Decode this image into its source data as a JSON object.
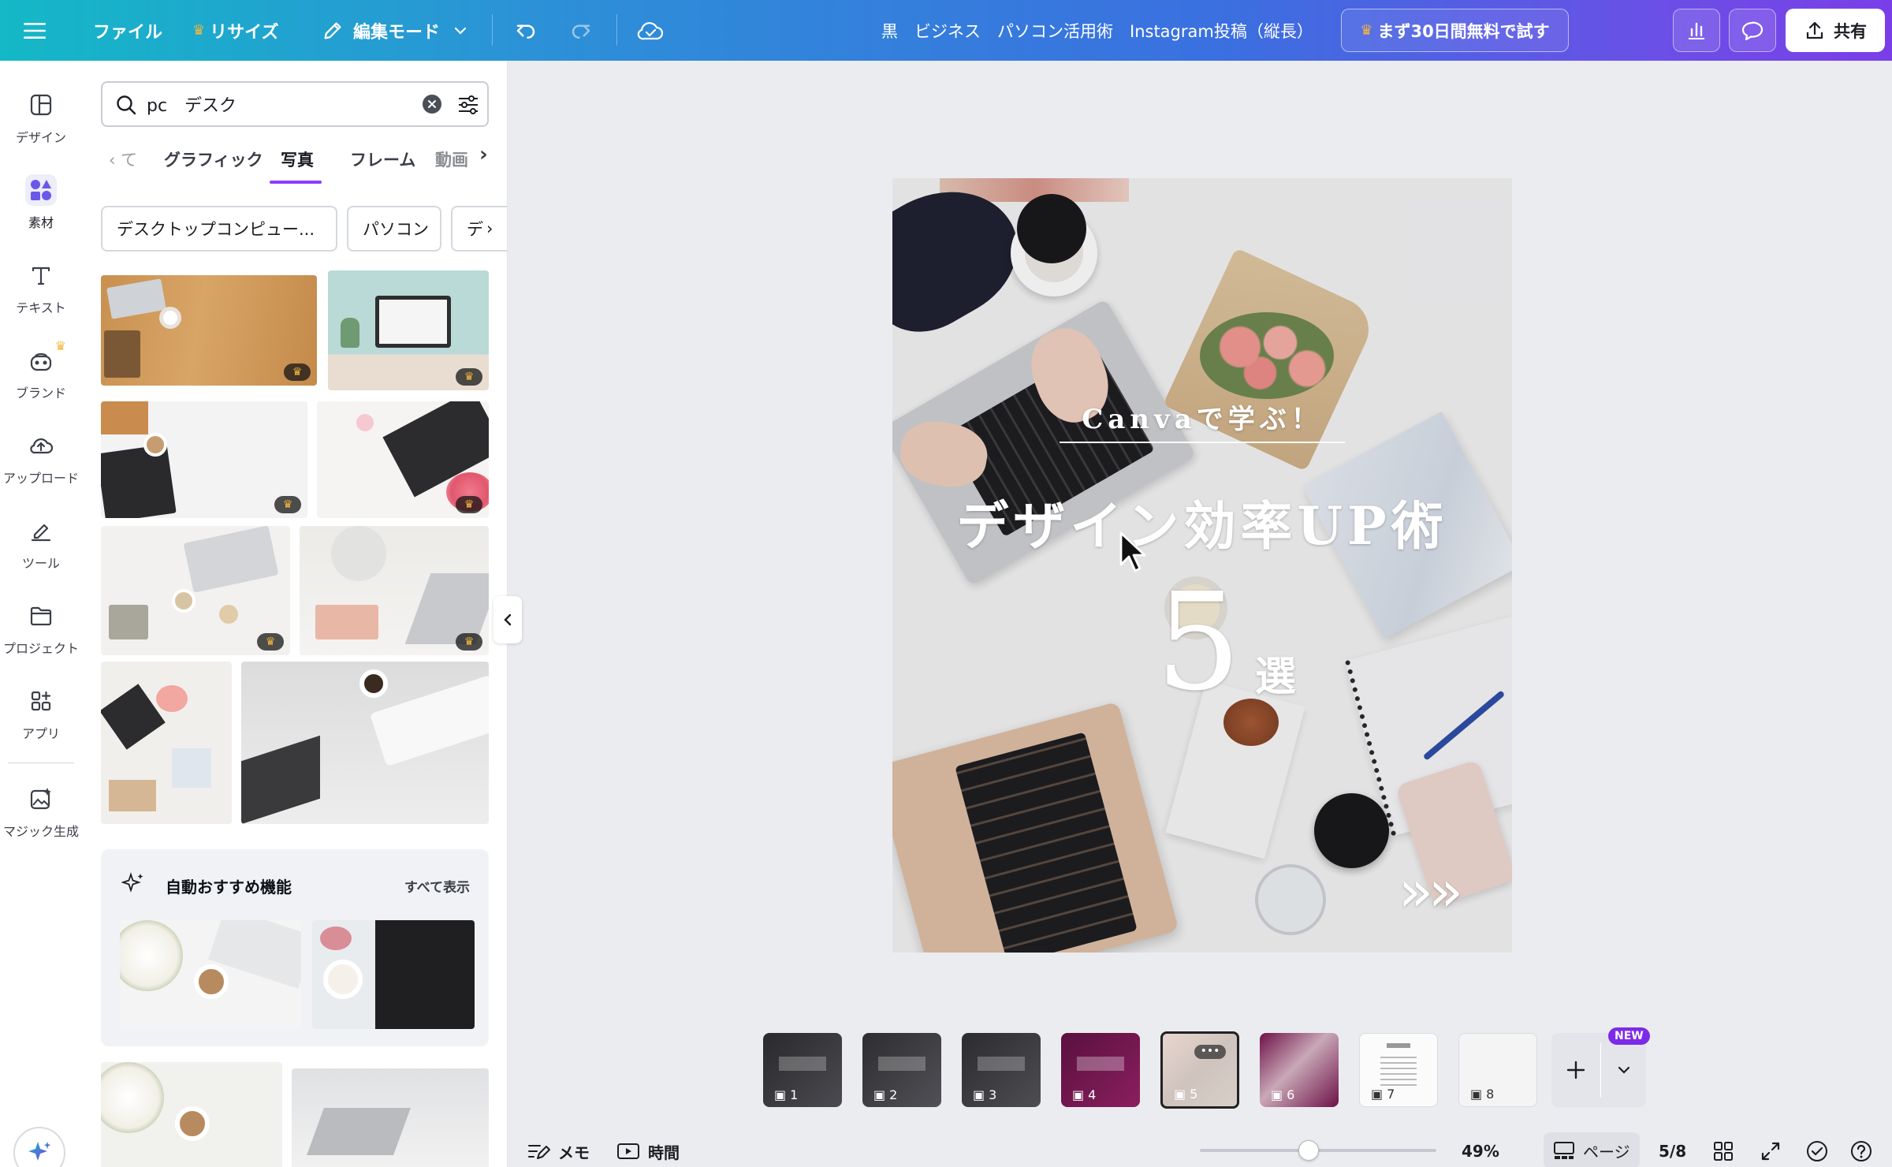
{
  "topbar": {
    "file_label": "ファイル",
    "resize_label": "リサイズ",
    "edit_mode_label": "編集モード",
    "doc_title": "黒　ビジネス　パソコン活用術　Instagram投稿（縦長）",
    "trial_label": "まず30日間無料で試す",
    "share_label": "共有"
  },
  "rail": {
    "items": [
      {
        "label": "デザイン",
        "icon": "design-icon"
      },
      {
        "label": "素材",
        "icon": "elements-icon"
      },
      {
        "label": "テキスト",
        "icon": "text-icon"
      },
      {
        "label": "ブランド",
        "icon": "brand-icon"
      },
      {
        "label": "アップロード",
        "icon": "upload-icon"
      },
      {
        "label": "ツール",
        "icon": "tools-icon"
      },
      {
        "label": "プロジェクト",
        "icon": "projects-icon"
      },
      {
        "label": "アプリ",
        "icon": "apps-icon"
      },
      {
        "label": "マジック生成",
        "icon": "magic-media-icon"
      }
    ]
  },
  "panel": {
    "search_value": "pc　デスク",
    "tabs": [
      "て",
      "グラフィック",
      "写真",
      "フレーム",
      "動画"
    ],
    "active_tab": "写真",
    "chips": [
      "デスクトップコンピュー...",
      "パソコン",
      "デ"
    ],
    "suggest_title": "自動おすすめ機能",
    "suggest_see_all": "すべて表示"
  },
  "design": {
    "subtitle": "Canvaで学ぶ！",
    "title": "デザイン効率UP術",
    "number": "5",
    "unit": "選",
    "arrows": "»»"
  },
  "pages": {
    "numbers": [
      "1",
      "2",
      "3",
      "4",
      "5",
      "6",
      "7",
      "8"
    ],
    "current": "5",
    "new_badge": "NEW"
  },
  "bottombar": {
    "notes_label": "メモ",
    "timer_label": "時間",
    "zoom": "49%",
    "zoom_fraction": 0.46,
    "pages_label": "ページ",
    "page_count": "5/8"
  },
  "colors": {
    "accent_purple": "#8b3dff",
    "crown_gold": "#f5b73b",
    "topbar_start": "#14b8c6",
    "topbar_end": "#7a3ee8"
  }
}
